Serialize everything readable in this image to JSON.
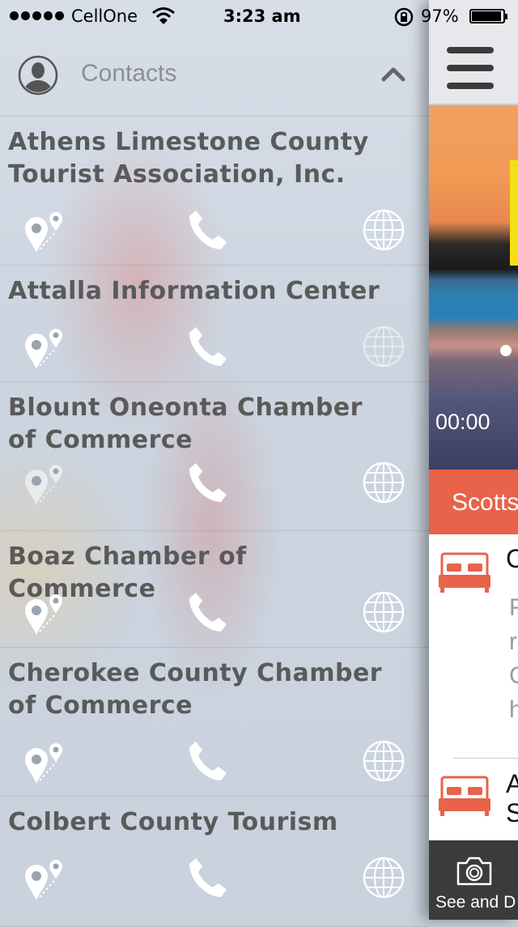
{
  "status_bar": {
    "carrier": "CellOne",
    "time": "3:23 am",
    "battery": "97%"
  },
  "drawer": {
    "title": "Contacts",
    "contacts": [
      {
        "name": "Athens Limestone County Tourist Association, Inc.",
        "map_active": true,
        "phone_active": true,
        "web_active": true
      },
      {
        "name": "Attalla Information Center",
        "map_active": true,
        "phone_active": true,
        "web_active": false
      },
      {
        "name": "Blount Oneonta Chamber of Commerce",
        "map_active": false,
        "phone_active": true,
        "web_active": true
      },
      {
        "name": "Boaz Chamber of Commerce",
        "map_active": true,
        "phone_active": true,
        "web_active": true
      },
      {
        "name": "Cherokee County Chamber of Commerce",
        "map_active": true,
        "phone_active": true,
        "web_active": true
      },
      {
        "name": "Colbert County Tourism",
        "map_active": true,
        "phone_active": true,
        "web_active": true
      }
    ]
  },
  "main": {
    "timecode": "00:00",
    "cta_label": "Scotts",
    "row1_char": "C",
    "row1_desc": "F\nr\nC\nh",
    "row2_chars": "A\nS",
    "tab_label": "See and D"
  },
  "colors": {
    "accent": "#e8634a",
    "tabbar": "#3b3b3b"
  }
}
